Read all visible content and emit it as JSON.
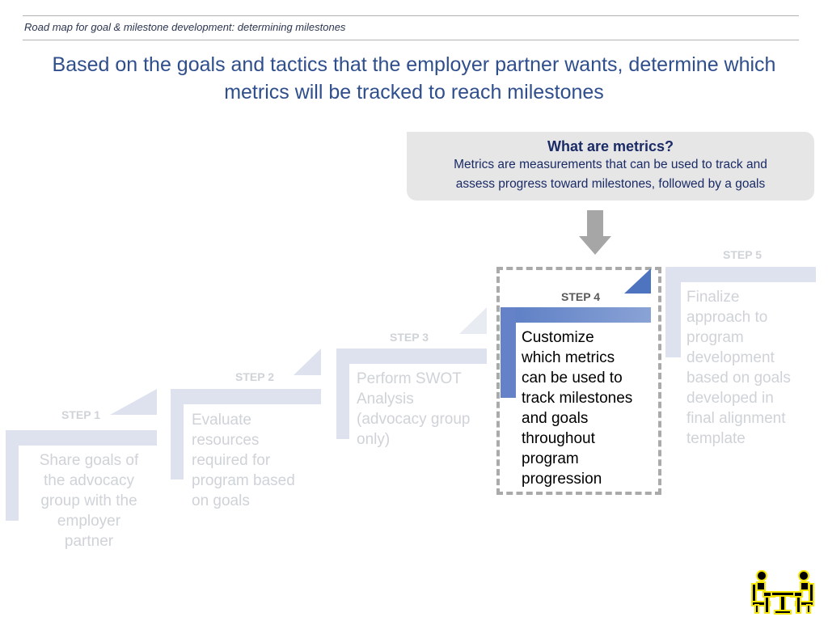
{
  "header": {
    "subtitle": "Road map for goal & milestone development: determining milestones",
    "headline_line1": "Based on the goals and tactics that the employer partner wants, determine which",
    "headline_line2": "metrics will be tracked to reach milestones"
  },
  "callout": {
    "title": "What are metrics?",
    "body_line1": "Metrics are measurements that can be used to track and",
    "body_line2": "assess progress toward milestones, followed by a goals",
    "arrow_icon": "down-arrow-icon"
  },
  "steps": [
    {
      "label": "STEP 1",
      "lines": [
        "Share goals of",
        "the advocacy",
        "group with the",
        "employer",
        "partner"
      ],
      "active": false
    },
    {
      "label": "STEP 2",
      "lines": [
        "Evaluate",
        "resources",
        "required for",
        "program based",
        "on goals"
      ],
      "active": false
    },
    {
      "label": "STEP 3",
      "lines": [
        "Perform SWOT",
        "Analysis",
        "(advocacy group",
        "only)"
      ],
      "active": false
    },
    {
      "label": "STEP 4",
      "lines": [
        "Customize",
        "which metrics",
        "can be used to",
        "track milestones",
        "and goals",
        "throughout",
        "program",
        "progression"
      ],
      "active": true
    },
    {
      "label": "STEP 5",
      "lines": [
        "Finalize",
        "approach to",
        "program",
        "development",
        "based on goals",
        "developed in",
        "final alignment",
        "template"
      ],
      "active": false
    }
  ],
  "colors": {
    "accent": "#4f74bf",
    "faded_bar": "#dde2ee",
    "title": "#2f4e8c",
    "logo": "#f5e600"
  },
  "logo_icon": "meeting-people-icon"
}
